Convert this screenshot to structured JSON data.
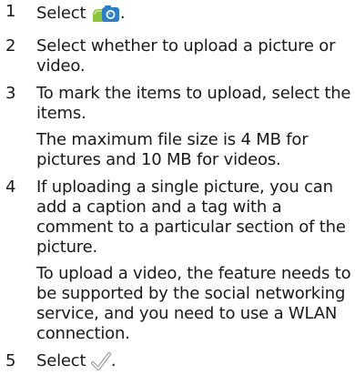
{
  "steps": [
    {
      "number": "1",
      "text_before_icon": "Select ",
      "icon": "camera-upload-icon",
      "text_after_icon": "."
    },
    {
      "number": "2",
      "text": "Select whether to upload a picture or video."
    },
    {
      "number": "3",
      "text": "To mark the items to upload, select the items.",
      "note": "The maximum file size is 4 MB for pictures and 10 MB for videos."
    },
    {
      "number": "4",
      "text": "If uploading a single picture, you can add a caption and a tag with a comment to a particular section of the picture.",
      "note": "To upload a video, the feature needs to be supported by the social networking service, and you need to use a WLAN connection."
    },
    {
      "number": "5",
      "text_before_icon": "Select ",
      "icon": "checkmark-icon",
      "text_after_icon": "."
    }
  ],
  "colors": {
    "camera_green": "#8cc43c",
    "camera_blue": "#2f7fc4",
    "checkmark_gray": "#9a9a9a"
  }
}
